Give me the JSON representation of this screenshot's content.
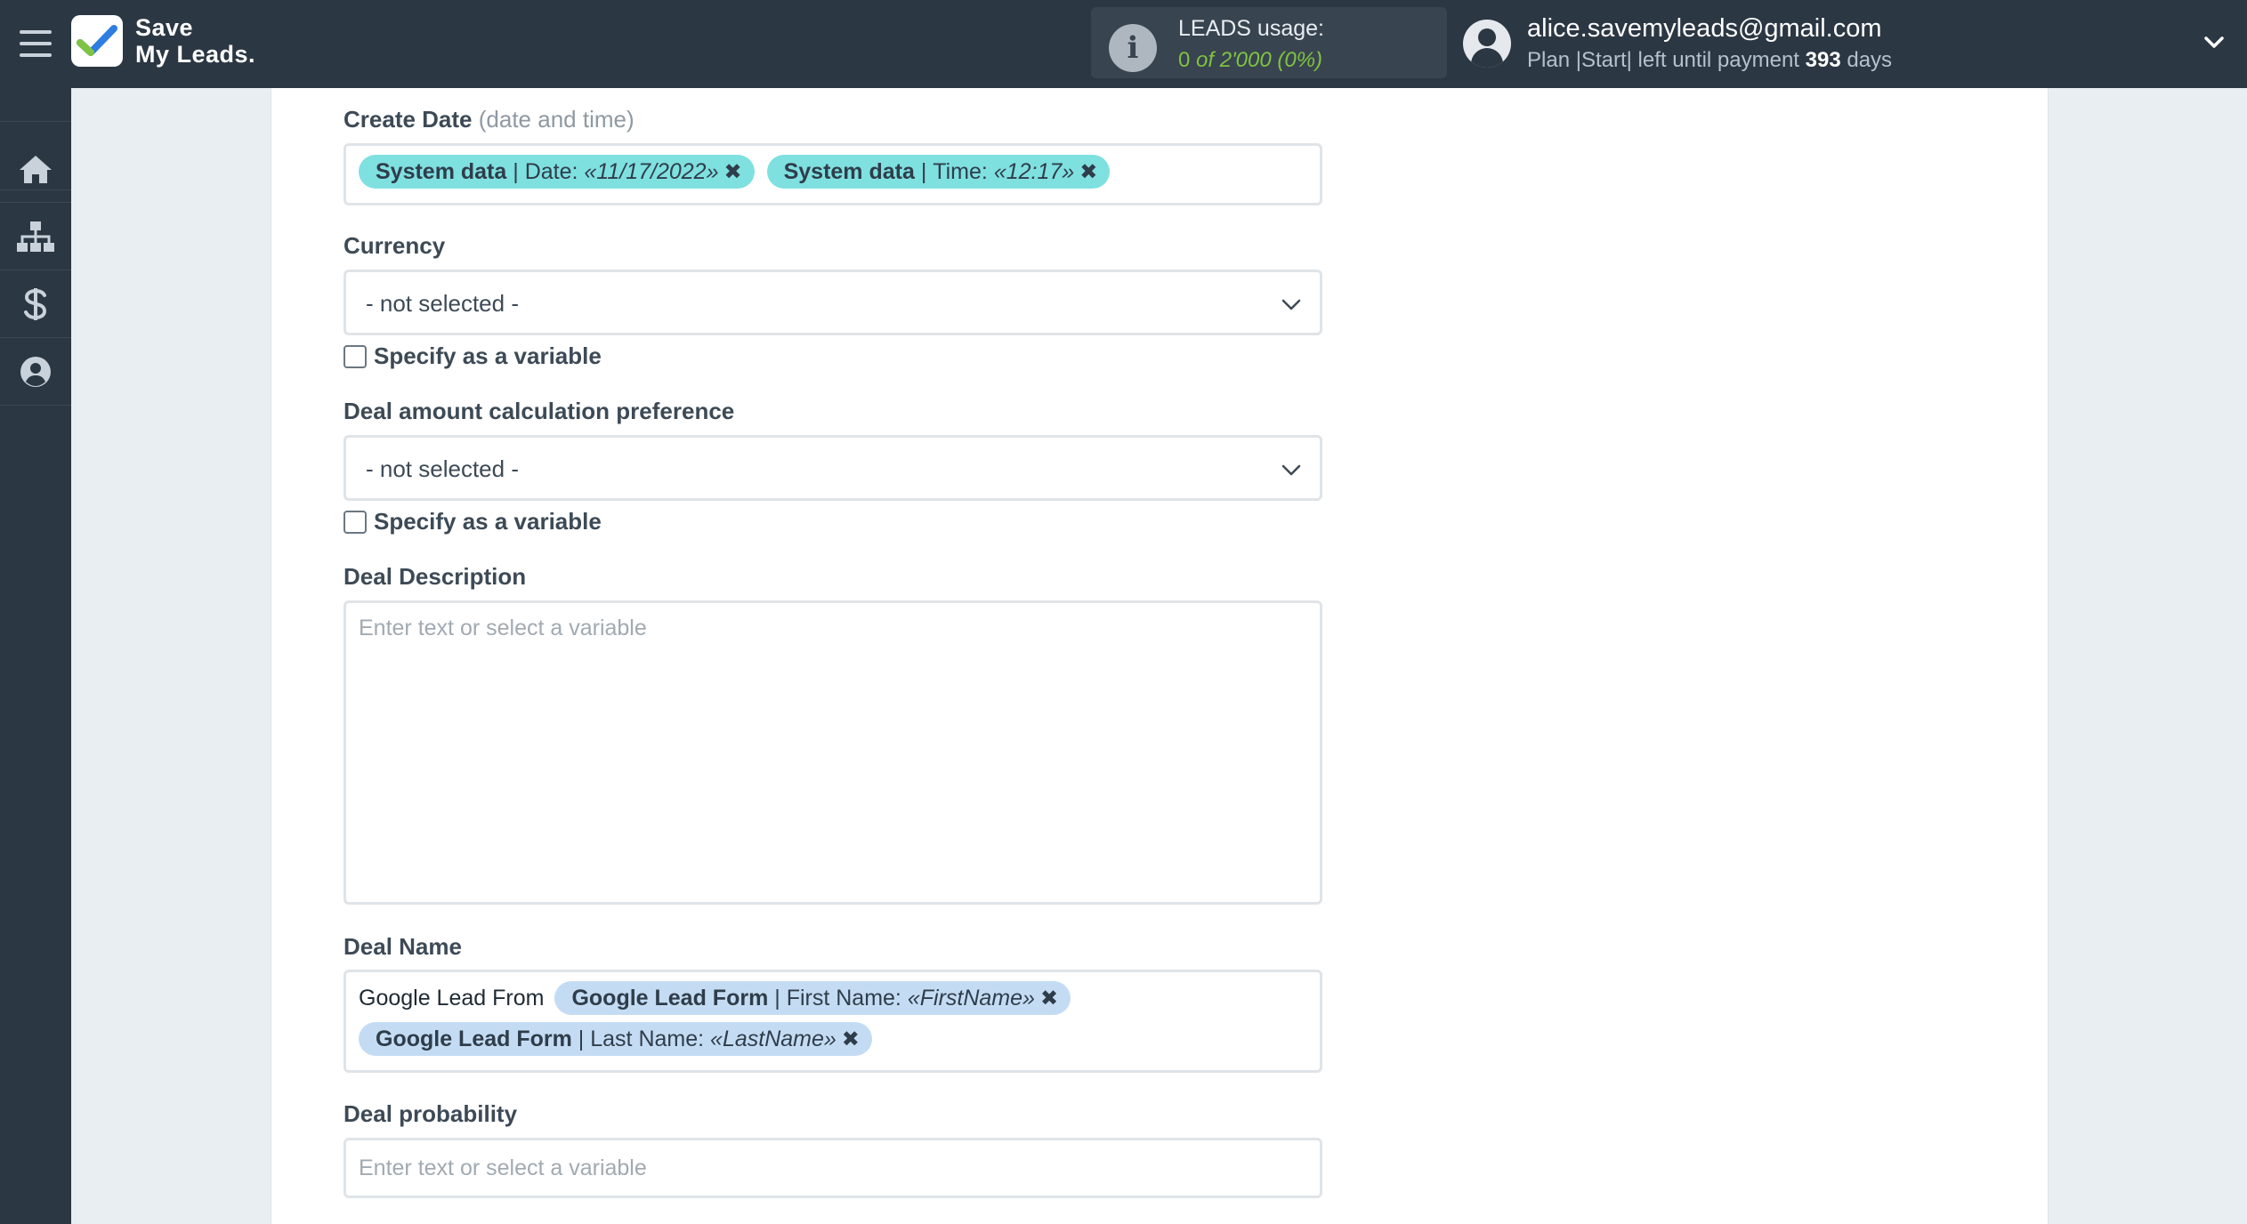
{
  "app": {
    "logo_line1": "Save",
    "logo_line2": "My Leads."
  },
  "usage": {
    "title": "LEADS usage:",
    "count": "0",
    "of_total": "of 2'000",
    "percent": "(0%)"
  },
  "account": {
    "email": "alice.savemyleads@gmail.com",
    "plan_prefix": "Plan |Start| left until payment",
    "days_count": "393",
    "days_suffix": "days"
  },
  "sidebar": {
    "items": [
      {
        "name": "home",
        "icon": "home-icon"
      },
      {
        "name": "connections",
        "icon": "sitemap-icon"
      },
      {
        "name": "billing",
        "icon": "dollar-icon"
      },
      {
        "name": "profile",
        "icon": "user-circle-icon"
      }
    ]
  },
  "form": {
    "create_date": {
      "label": "Create Date",
      "hint": "(date and time)",
      "tags": [
        {
          "source": "System data",
          "field": "Date:",
          "value": "«11/17/2022»"
        },
        {
          "source": "System data",
          "field": "Time:",
          "value": "«12:17»"
        }
      ]
    },
    "currency": {
      "label": "Currency",
      "selected": "- not selected -",
      "checkbox_label": "Specify as a variable"
    },
    "deal_amount": {
      "label": "Deal amount calculation preference",
      "selected": "- not selected -",
      "checkbox_label": "Specify as a variable"
    },
    "deal_description": {
      "label": "Deal Description",
      "placeholder": "Enter text or select a variable"
    },
    "deal_name": {
      "label": "Deal Name",
      "prefix_text": "Google Lead From",
      "tags": [
        {
          "source": "Google Lead Form",
          "field": "First Name:",
          "value": "«FirstName»"
        },
        {
          "source": "Google Lead Form",
          "field": "Last Name:",
          "value": "«LastName»"
        }
      ]
    },
    "deal_probability": {
      "label": "Deal probability",
      "placeholder": "Enter text or select a variable"
    }
  },
  "colors": {
    "topbar": "#2b3743",
    "system_tag": "#7fe0e0",
    "google_tag": "#c4dcf3",
    "usage_green": "#7fc342"
  }
}
